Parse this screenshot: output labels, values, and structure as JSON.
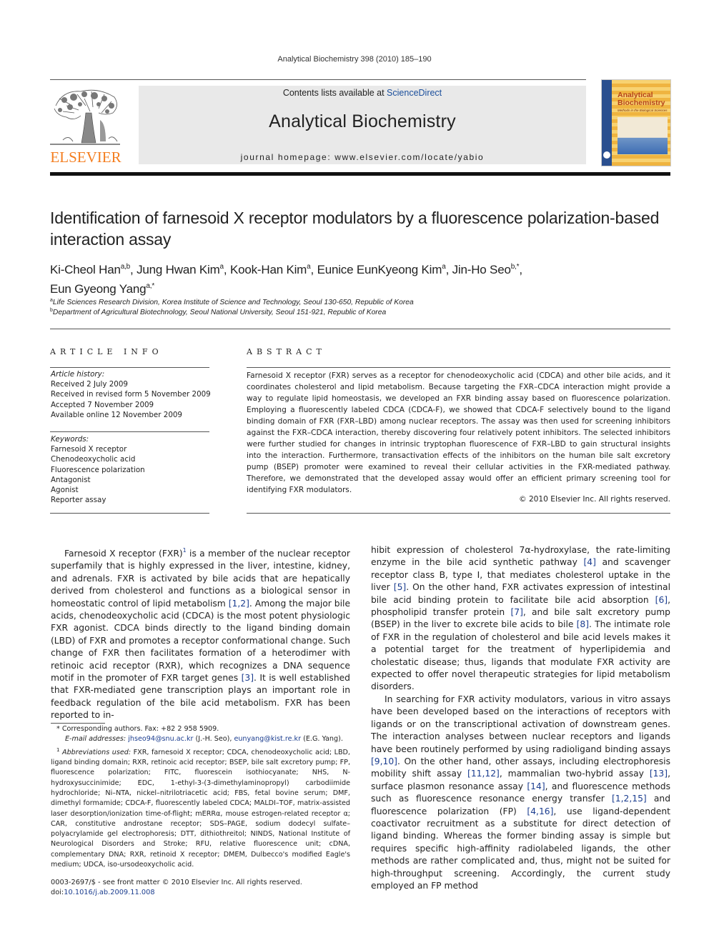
{
  "running_head": "Analytical Biochemistry 398 (2010) 185–190",
  "header": {
    "publisher_logo_text": "ELSEVIER",
    "contents_prefix": "Contents lists available at ",
    "contents_link": "ScienceDirect",
    "journal_name": "Analytical Biochemistry",
    "homepage": "journal homepage: www.elsevier.com/locate/yabio",
    "cover_title_line1": "Analytical",
    "cover_title_line2": "Biochemistry",
    "cover_subtitle": "Methods in the Biological Sciences",
    "colors": {
      "elsevier_orange": "#f47e20",
      "link_blue": "#1b3d8f",
      "banner_gray": "#e9e9e9"
    }
  },
  "article": {
    "title": "Identification of farnesoid X receptor modulators by a fluorescence polarization-based interaction assay",
    "authors": [
      {
        "name": "Ki-Cheol Han",
        "sup": "a,b",
        "sep": ", "
      },
      {
        "name": "Jung Hwan Kim",
        "sup": "a",
        "sep": ", "
      },
      {
        "name": "Kook-Han Kim",
        "sup": "a",
        "sep": ", "
      },
      {
        "name": "Eunice EunKyeong Kim",
        "sup": "a",
        "sep": ", "
      },
      {
        "name": "Jin-Ho Seo",
        "sup": "b,*",
        "sep": ","
      },
      {
        "name": "Eun Gyeong Yang",
        "sup": "a,*",
        "sep": ""
      }
    ],
    "affiliations": [
      {
        "mark": "a",
        "text": "Life Sciences Research Division, Korea Institute of Science and Technology, Seoul 130-650, Republic of Korea"
      },
      {
        "mark": "b",
        "text": "Department of Agricultural Biotechnology, Seoul National University, Seoul 151-921, Republic of Korea"
      }
    ]
  },
  "article_info": {
    "heading": "ARTICLE INFO",
    "history_label": "Article history:",
    "history": [
      "Received 2 July 2009",
      "Received in revised form 5 November 2009",
      "Accepted 7 November 2009",
      "Available online 12 November 2009"
    ],
    "keywords_label": "Keywords:",
    "keywords": [
      "Farnesoid X receptor",
      "Chenodeoxycholic acid",
      "Fluorescence polarization",
      "Antagonist",
      "Agonist",
      "Reporter assay"
    ]
  },
  "abstract": {
    "heading": "ABSTRACT",
    "text": "Farnesoid X receptor (FXR) serves as a receptor for chenodeoxycholic acid (CDCA) and other bile acids, and it coordinates cholesterol and lipid metabolism. Because targeting the FXR–CDCA interaction might provide a way to regulate lipid homeostasis, we developed an FXR binding assay based on fluorescence polarization. Employing a fluorescently labeled CDCA (CDCA-F), we showed that CDCA-F selectively bound to the ligand binding domain of FXR (FXR–LBD) among nuclear receptors. The assay was then used for screening inhibitors against the FXR–CDCA interaction, thereby discovering four relatively potent inhibitors. The selected inhibitors were further studied for changes in intrinsic tryptophan fluorescence of FXR–LBD to gain structural insights into the interaction. Furthermore, transactivation effects of the inhibitors on the human bile salt excretory pump (BSEP) promoter were examined to reveal their cellular activities in the FXR-mediated pathway. Therefore, we demonstrated that the developed assay would offer an efficient primary screening tool for identifying FXR modulators.",
    "copyright": "© 2010 Elsevier Inc. All rights reserved."
  },
  "body": {
    "left_col": {
      "p1_a": "Farnesoid X receptor (FXR)",
      "p1_fn": "1",
      "p1_b": " is a member of the nuclear receptor superfamily that is highly expressed in the liver, intestine, kidney, and adrenals. FXR is activated by bile acids that are hepatically derived from cholesterol and functions as a biological sensor in homeostatic control of lipid metabolism ",
      "p1_ref1": "[1,2]",
      "p1_c": ". Among the major bile acids, chenodeoxycholic acid (CDCA) is the most potent physiologic FXR agonist. CDCA binds directly to the ligand binding domain (LBD) of FXR and promotes a receptor conformational change. Such change of FXR then facilitates formation of a heterodimer with retinoic acid receptor (RXR), which recognizes a DNA sequence motif in the promoter of FXR target genes ",
      "p1_ref2": "[3]",
      "p1_d": ". It is well established that FXR-mediated gene transcription plays an important role in feedback regulation of the bile acid metabolism. FXR has been reported to in-"
    },
    "right_col": {
      "p1_a": "hibit expression of cholesterol 7α-hydroxylase, the rate-limiting enzyme in the bile acid synthetic pathway ",
      "p1_r4": "[4]",
      "p1_b": " and scavenger receptor class B, type I, that mediates cholesterol uptake in the liver ",
      "p1_r5": "[5]",
      "p1_c": ". On the other hand, FXR activates expression of intestinal bile acid binding protein to facilitate bile acid absorption ",
      "p1_r6": "[6]",
      "p1_d": ", phospholipid transfer protein ",
      "p1_r7": "[7]",
      "p1_e": ", and bile salt excretory pump (BSEP) in the liver to excrete bile acids to bile ",
      "p1_r8": "[8]",
      "p1_f": ". The intimate role of FXR in the regulation of cholesterol and bile acid levels makes it a potential target for the treatment of hyperlipidemia and cholestatic disease; thus, ligands that modulate FXR activity are expected to offer novel therapeutic strategies for lipid metabolism disorders.",
      "p2_a": "In searching for FXR activity modulators, various in vitro assays have been developed based on the interactions of receptors with ligands or on the transcriptional activation of downstream genes. The interaction analyses between nuclear receptors and ligands have been routinely performed by using radioligand binding assays ",
      "p2_r1": "[9,10]",
      "p2_b": ". On the other hand, other assays, including electrophoresis mobility shift assay ",
      "p2_r2": "[11,12]",
      "p2_c": ", mammalian two-hybrid assay ",
      "p2_r3": "[13]",
      "p2_d": ", surface plasmon resonance assay ",
      "p2_r4": "[14]",
      "p2_e": ", and fluorescence methods such as fluorescence resonance energy transfer ",
      "p2_r5": "[1,2,15]",
      "p2_f": " and fluorescence polarization (FP) ",
      "p2_r6": "[4,16]",
      "p2_g": ", use ligand-dependent coactivator recruitment as a substitute for direct detection of ligand binding. Whereas the former binding assay is simple but requires specific high-affinity radiolabeled ligands, the other methods are rather complicated and, thus, might not be suited for high-throughput screening. Accordingly, the current study employed an FP method"
    }
  },
  "footnotes": {
    "corresponding": "* Corresponding authors. Fax: +82 2 958 5909.",
    "email_label": "E-mail addresses: ",
    "email1": "jhseo94@snu.ac.kr",
    "email1_who": " (J.-H. Seo), ",
    "email2": "eunyang@kist.re.kr",
    "email2_who": " (E.G. Yang).",
    "abbrev_mark": "1",
    "abbrev_label": "Abbreviations used:",
    "abbrev_text": " FXR, farnesoid X receptor; CDCA, chenodeoxycholic acid; LBD, ligand binding domain; RXR, retinoic acid receptor; BSEP, bile salt excretory pump; FP, fluorescence polarization; FITC, fluorescein isothiocyanate; NHS, N-hydroxysuccinimide; EDC, 1-ethyl-3-(3-dimethylaminopropyl) carbodiimide hydrochloride; Ni–NTA, nickel–nitrilotriacetic acid; FBS, fetal bovine serum; DMF, dimethyl formamide; CDCA-F, fluorescently labeled CDCA; MALDI–TOF, matrix-assisted laser desorption/ionization time-of-flight; mERRα, mouse estrogen-related receptor α; CAR, constitutive androstane receptor; SDS–PAGE, sodium dodecyl sulfate–polyacrylamide gel electrophoresis; DTT, dithiothreitol; NINDS, National Institute of Neurological Disorders and Stroke; RFU, relative fluorescence unit; cDNA, complementary DNA; RXR, retinoid X receptor; DMEM, Dulbecco's modified Eagle's medium; UDCA, iso-ursodeoxycholic acid."
  },
  "front_matter": {
    "issn_line": "0003-2697/$ - see front matter © 2010 Elsevier Inc. All rights reserved.",
    "doi_prefix": "doi:",
    "doi": "10.1016/j.ab.2009.11.008"
  }
}
